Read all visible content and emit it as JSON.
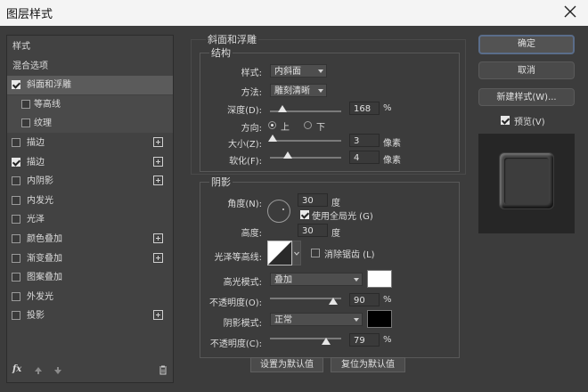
{
  "window": {
    "title": "图层样式"
  },
  "left_panel": {
    "items": [
      {
        "label": "样式",
        "checkbox": false,
        "checked": false,
        "plus": false
      },
      {
        "label": "混合选项",
        "checkbox": false,
        "checked": false,
        "plus": false
      },
      {
        "label": "斜面和浮雕",
        "checkbox": true,
        "checked": true,
        "plus": false,
        "selected": true
      },
      {
        "label": "等高线",
        "checkbox": true,
        "checked": false,
        "plus": false,
        "sub": true
      },
      {
        "label": "纹理",
        "checkbox": true,
        "checked": false,
        "plus": false,
        "sub": true
      },
      {
        "label": "描边",
        "checkbox": true,
        "checked": false,
        "plus": true
      },
      {
        "label": "描边",
        "checkbox": true,
        "checked": true,
        "plus": true
      },
      {
        "label": "内阴影",
        "checkbox": true,
        "checked": false,
        "plus": true
      },
      {
        "label": "内发光",
        "checkbox": true,
        "checked": false,
        "plus": false
      },
      {
        "label": "光泽",
        "checkbox": true,
        "checked": false,
        "plus": false
      },
      {
        "label": "颜色叠加",
        "checkbox": true,
        "checked": false,
        "plus": true
      },
      {
        "label": "渐变叠加",
        "checkbox": true,
        "checked": false,
        "plus": true
      },
      {
        "label": "图案叠加",
        "checkbox": true,
        "checked": false,
        "plus": false
      },
      {
        "label": "外发光",
        "checkbox": true,
        "checked": false,
        "plus": false
      },
      {
        "label": "投影",
        "checkbox": true,
        "checked": false,
        "plus": true
      }
    ],
    "fx_label": "fx"
  },
  "bevel": {
    "section_title": "斜面和浮雕",
    "structure_title": "结构",
    "style_label": "样式:",
    "style_value": "内斜面",
    "technique_label": "方法:",
    "technique_value": "雕刻清晰",
    "depth_label": "深度(D):",
    "depth_value": "168",
    "depth_unit": "%",
    "direction_label": "方向:",
    "direction_up": "上",
    "direction_down": "下",
    "size_label": "大小(Z):",
    "size_value": "3",
    "size_unit": "像素",
    "soften_label": "软化(F):",
    "soften_value": "4",
    "soften_unit": "像素"
  },
  "shading": {
    "title": "阴影",
    "angle_label": "角度(N):",
    "angle_value": "30",
    "angle_unit": "度",
    "global_light_label": "使用全局光 (G)",
    "altitude_label": "高度:",
    "altitude_value": "30",
    "altitude_unit": "度",
    "gloss_label": "光泽等高线:",
    "antialias_label": "消除锯齿 (L)",
    "highlight_mode_label": "高光模式:",
    "highlight_mode_value": "叠加",
    "highlight_opacity_label": "不透明度(O):",
    "highlight_opacity_value": "90",
    "highlight_opacity_unit": "%",
    "shadow_mode_label": "阴影模式:",
    "shadow_mode_value": "正常",
    "shadow_opacity_label": "不透明度(C):",
    "shadow_opacity_value": "79",
    "shadow_opacity_unit": "%",
    "highlight_color": "#ffffff",
    "shadow_color": "#000000"
  },
  "bottom": {
    "set_default": "设置为默认值",
    "reset_default": "复位为默认值"
  },
  "right": {
    "ok": "确定",
    "cancel": "取消",
    "new_style": "新建样式(W)...",
    "preview_label": "预览(V)"
  },
  "sliders": {
    "depth": 0.1,
    "size": 0.02,
    "soften": 0.2,
    "highlight_opacity": 0.9,
    "shadow_opacity": 0.79
  }
}
